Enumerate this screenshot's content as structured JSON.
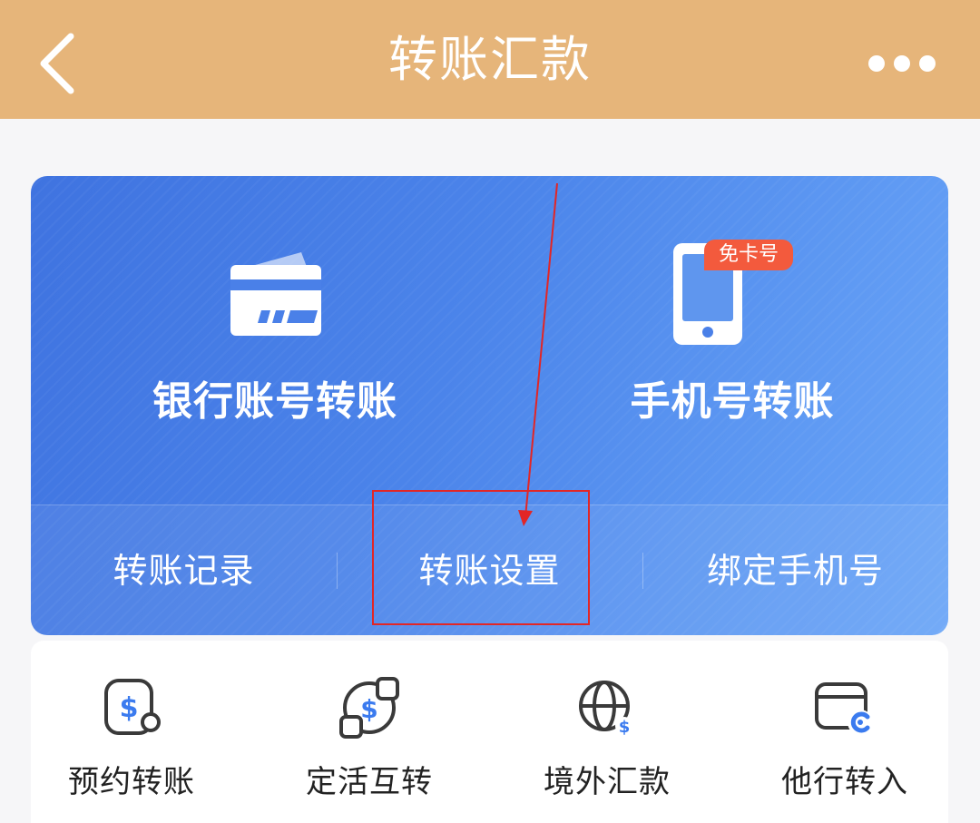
{
  "header": {
    "title": "转账汇款",
    "back_icon": "chevron-left-icon",
    "more_icon": "more-dots-icon",
    "background": "#e6b57a"
  },
  "hero": {
    "bank_transfer": {
      "label": "银行账号转账",
      "icon": "bank-card-icon"
    },
    "phone_transfer": {
      "label": "手机号转账",
      "icon": "phone-icon",
      "badge": "免卡号"
    },
    "gradient_start": "#3f73e0",
    "gradient_end": "#6aa5f7"
  },
  "sub_actions": [
    {
      "label": "转账记录"
    },
    {
      "label": "转账设置"
    },
    {
      "label": "绑定手机号"
    }
  ],
  "services": [
    {
      "label": "预约转账",
      "icon": "scheduled-transfer-icon"
    },
    {
      "label": "定活互转",
      "icon": "fixed-current-exchange-icon"
    },
    {
      "label": "境外汇款",
      "icon": "overseas-remittance-icon"
    },
    {
      "label": "他行转入",
      "icon": "other-bank-transfer-in-icon"
    }
  ],
  "annotation": {
    "color": "#e22626"
  }
}
